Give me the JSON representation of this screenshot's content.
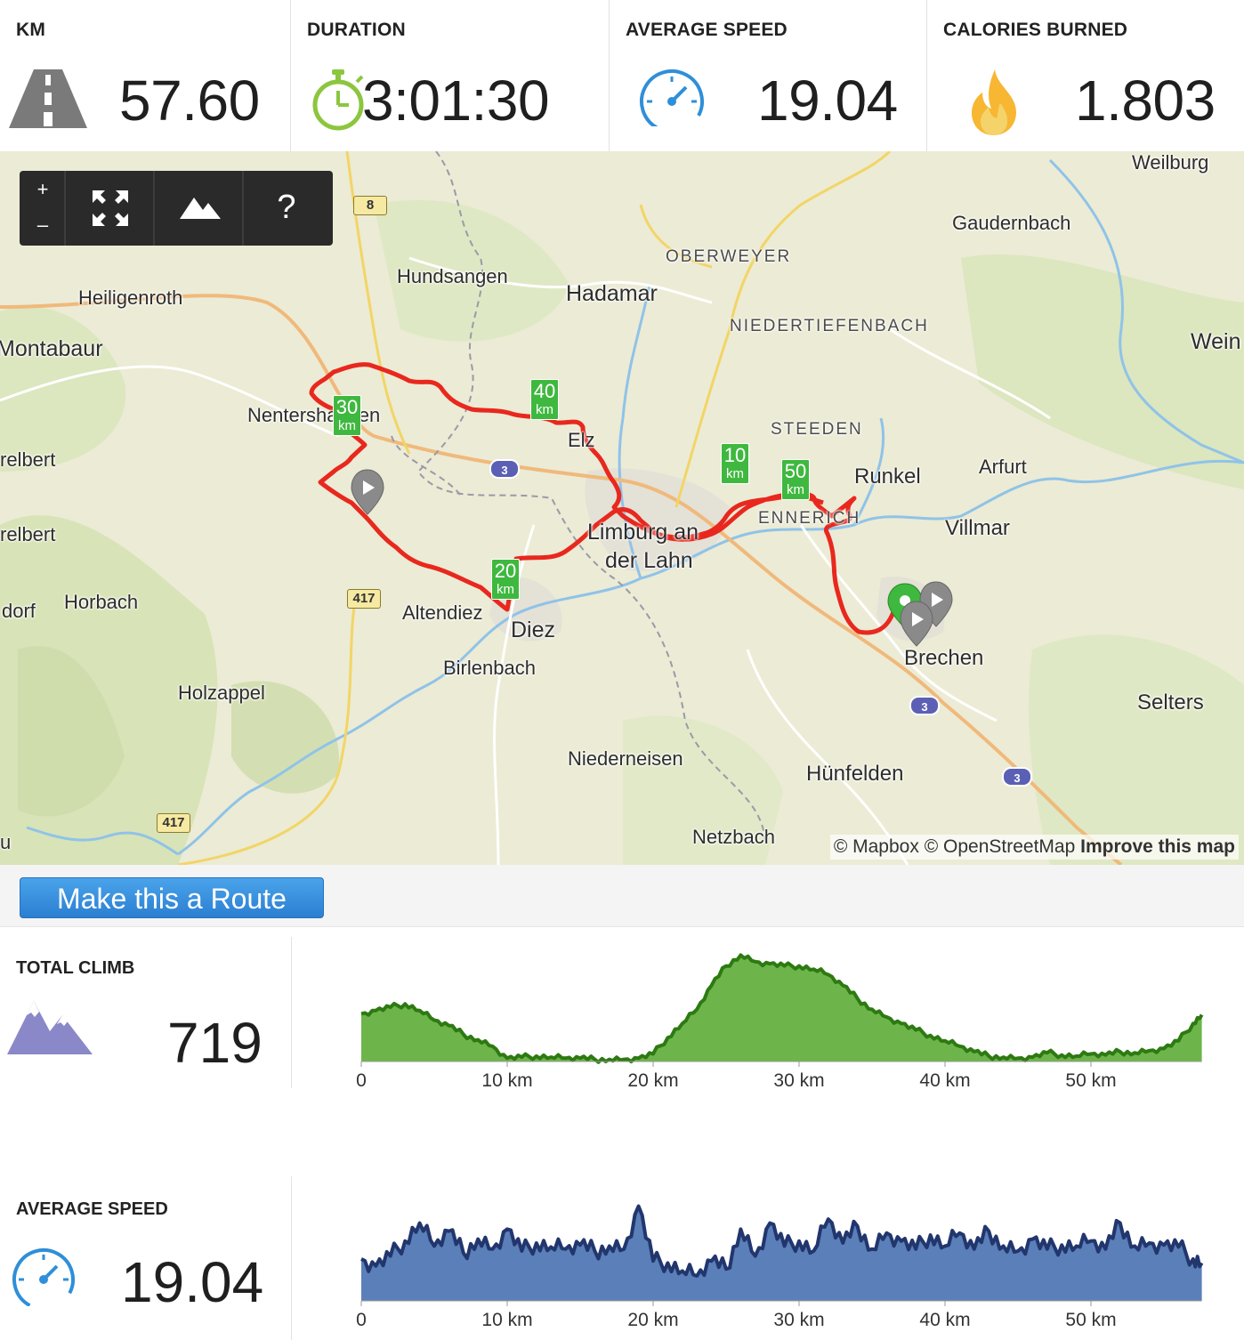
{
  "stats": [
    {
      "label": "KM",
      "value": "57.60",
      "icon": "road-icon"
    },
    {
      "label": "DURATION",
      "value": "3:01:30",
      "icon": "stopwatch-icon"
    },
    {
      "label": "AVERAGE SPEED",
      "value": "19.04",
      "icon": "speedometer-icon"
    },
    {
      "label": "CALORIES BURNED",
      "value": "1.803",
      "icon": "flame-icon"
    }
  ],
  "map": {
    "toolbar": {
      "zoom_in": "+",
      "zoom_out": "–",
      "help": "?"
    },
    "places": {
      "weilburg": "Weilburg",
      "gaudernbach": "Gaudernbach",
      "oberweyer": "OBERWEYER",
      "hundsangen": "Hundsangen",
      "hadamar": "Hadamar",
      "heiligenroth": "Heiligenroth",
      "niedertiefenbach": "NIEDERTIEFENBACH",
      "montabaur": "Montabaur",
      "wein": "Wein",
      "nentershausen": "Nentershausen",
      "steeden": "STEEDEN",
      "elz": "Elz",
      "runkel": "Runkel",
      "arfurt": "Arfurt",
      "relbert1": "relbert",
      "relbert2": "relbert",
      "villmar": "Villmar",
      "limburg": "Limburg an",
      "der_lahn": "der Lahn",
      "ennerich": "ENNERICH",
      "dorf": "dorf",
      "horbach": "Horbach",
      "altendiez": "Altendiez",
      "diez": "Diez",
      "birlenbach": "Birlenbach",
      "brechen": "Brechen",
      "holzappel": "Holzappel",
      "selters": "Selters",
      "niederneisen": "Niederneisen",
      "huenfelden": "Hünfelden",
      "netzbach": "Netzbach",
      "u": "u"
    },
    "road_shields": {
      "a3": "3",
      "b8": "8",
      "b417": "417"
    },
    "km_markers": [
      {
        "n": "10",
        "u": "km"
      },
      {
        "n": "20",
        "u": "km"
      },
      {
        "n": "30",
        "u": "km"
      },
      {
        "n": "40",
        "u": "km"
      },
      {
        "n": "50",
        "u": "km"
      }
    ],
    "attribution": {
      "mapbox": "© Mapbox",
      "osm": "© OpenStreetMap",
      "improve": "Improve this map"
    },
    "route_color": "#e8281e"
  },
  "route_button": {
    "label": "Make this a Route"
  },
  "climb": {
    "label": "TOTAL CLIMB",
    "value": "719",
    "icon": "mountain-icon",
    "fill": "#6db54a",
    "stroke": "#2d7a12",
    "chart_data": {
      "type": "area",
      "x_ticks": [
        "0",
        "10 km",
        "20 km",
        "30 km",
        "40 km",
        "50 km"
      ],
      "x_unit": "km",
      "xlim": [
        0,
        57.6
      ],
      "x": [
        0,
        1,
        2,
        3,
        4,
        5,
        6,
        7,
        8,
        9,
        10,
        11,
        12,
        13,
        14,
        15,
        16,
        17,
        18,
        19,
        20,
        21,
        22,
        23,
        24,
        25,
        26,
        27,
        28,
        29,
        30,
        31,
        32,
        33,
        34,
        35,
        36,
        37,
        38,
        39,
        40,
        41,
        42,
        43,
        44,
        45,
        46,
        47,
        48,
        49,
        50,
        51,
        52,
        53,
        54,
        55,
        56,
        57,
        57.6
      ],
      "y": [
        0.44,
        0.47,
        0.5,
        0.53,
        0.47,
        0.38,
        0.33,
        0.25,
        0.2,
        0.14,
        0.03,
        0.04,
        0.05,
        0.04,
        0.03,
        0.03,
        0.02,
        0.02,
        0.02,
        0.03,
        0.07,
        0.22,
        0.35,
        0.48,
        0.7,
        0.88,
        0.98,
        0.92,
        0.9,
        0.88,
        0.88,
        0.85,
        0.8,
        0.7,
        0.58,
        0.48,
        0.41,
        0.35,
        0.29,
        0.24,
        0.19,
        0.14,
        0.09,
        0.05,
        0.04,
        0.03,
        0.04,
        0.08,
        0.06,
        0.05,
        0.07,
        0.06,
        0.09,
        0.08,
        0.1,
        0.12,
        0.19,
        0.35,
        0.43
      ]
    }
  },
  "speed": {
    "label": "AVERAGE SPEED",
    "value": "19.04",
    "icon": "speedometer-icon",
    "fill": "#5b7fb8",
    "stroke": "#22366e",
    "chart_data": {
      "type": "area",
      "x_ticks": [
        "0",
        "10 km",
        "20 km",
        "30 km",
        "40 km",
        "50 km"
      ],
      "x_unit": "km",
      "xlim": [
        0,
        57.6
      ],
      "x": [
        0,
        1,
        2,
        3,
        4,
        5,
        6,
        7,
        8,
        9,
        10,
        11,
        12,
        13,
        14,
        15,
        16,
        17,
        18,
        19,
        20,
        21,
        22,
        23,
        24,
        25,
        26,
        27,
        28,
        29,
        30,
        31,
        32,
        33,
        34,
        35,
        36,
        37,
        38,
        39,
        40,
        41,
        42,
        43,
        44,
        45,
        46,
        47,
        48,
        49,
        50,
        51,
        52,
        53,
        54,
        55,
        56,
        57,
        57.6
      ],
      "y": [
        0.42,
        0.35,
        0.45,
        0.6,
        0.78,
        0.55,
        0.7,
        0.48,
        0.62,
        0.52,
        0.72,
        0.5,
        0.58,
        0.54,
        0.52,
        0.56,
        0.5,
        0.55,
        0.52,
        0.95,
        0.4,
        0.38,
        0.3,
        0.25,
        0.4,
        0.32,
        0.72,
        0.45,
        0.78,
        0.55,
        0.6,
        0.5,
        0.82,
        0.58,
        0.75,
        0.52,
        0.68,
        0.6,
        0.52,
        0.66,
        0.55,
        0.68,
        0.52,
        0.7,
        0.55,
        0.5,
        0.62,
        0.52,
        0.56,
        0.55,
        0.6,
        0.52,
        0.78,
        0.55,
        0.58,
        0.56,
        0.54,
        0.42,
        0.38
      ]
    }
  }
}
